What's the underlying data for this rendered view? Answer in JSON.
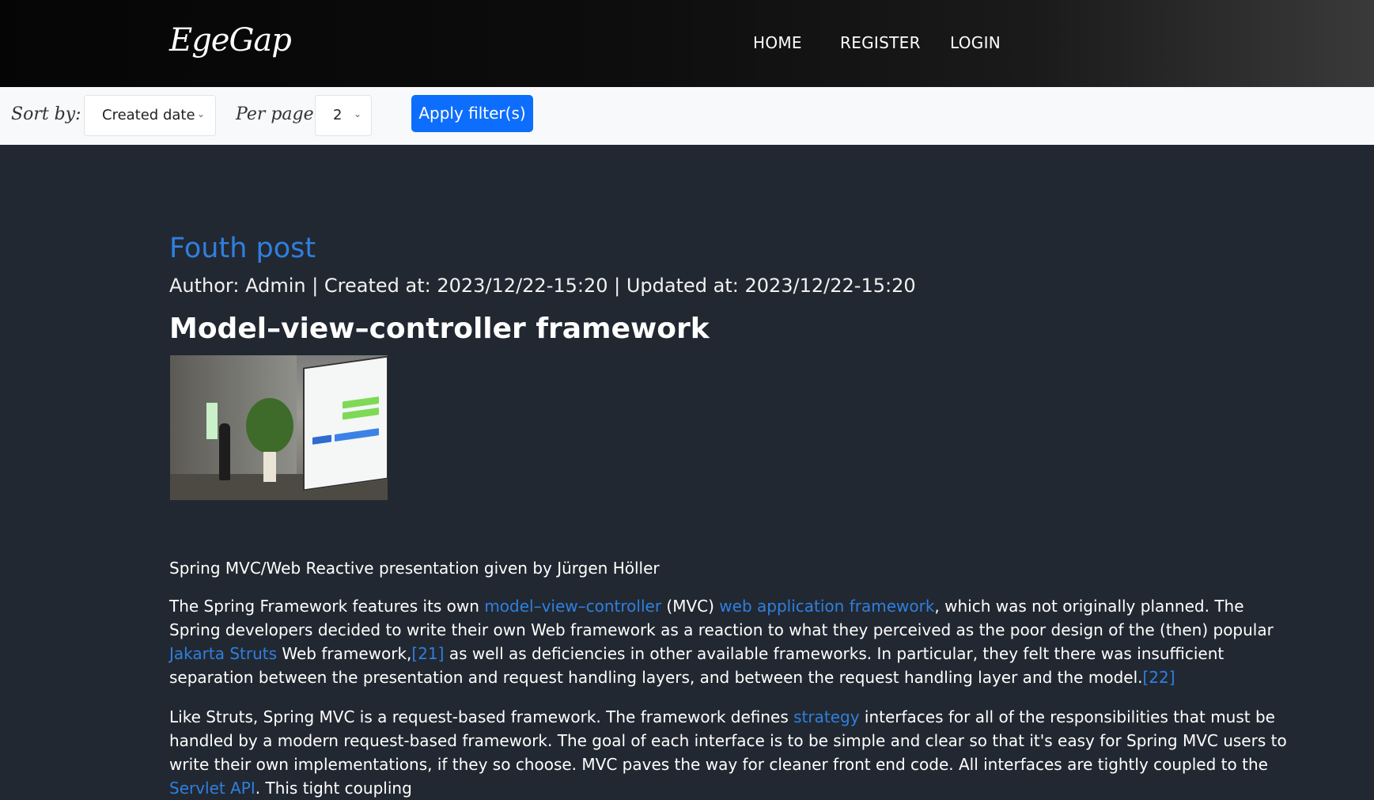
{
  "header": {
    "logo": "EgeGap",
    "nav": [
      "HOME",
      "REGISTER",
      "LOGIN"
    ]
  },
  "filters": {
    "sort_label": "Sort by:",
    "sort_value": "Created date",
    "per_page_label": "Per page:",
    "per_page_value": "2",
    "apply_label": "Apply filter(s)"
  },
  "post": {
    "title": "Fouth post",
    "meta": "Author: Admin | Created at: 2023/12/22-15:20 | Updated at: 2023/12/22-15:20",
    "heading": "Model–view–controller framework",
    "image_caption": "Spring MVC/Web Reactive presentation given by Jürgen Höller",
    "p1_a": "The Spring Framework features its own ",
    "p1_link1": "model–view–controller",
    "p1_b": " (MVC) ",
    "p1_link2": "web application framework",
    "p1_c": ", which was not originally planned. The Spring developers decided to write their own Web framework as a reaction to what they perceived as the poor design of the (then) popular ",
    "p1_link3": "Jakarta Struts",
    "p1_d": " Web framework,",
    "p1_ref1": "[21]",
    "p1_e": " as well as deficiencies in other available frameworks. In particular, they felt there was insufficient separation between the presentation and request handling layers, and between the request handling layer and the model.",
    "p1_ref2": "[22]",
    "p2_a": "Like Struts, Spring MVC is a request-based framework. The framework defines ",
    "p2_link1": "strategy",
    "p2_b": " interfaces for all of the responsibilities that must be handled by a modern request-based framework. The goal of each interface is to be simple and clear so that it's easy for Spring MVC users to write their own implementations, if they so choose. MVC paves the way for cleaner front end code. All interfaces are tightly coupled to the ",
    "p2_link2": "Servlet API",
    "p2_c": ". This tight coupling"
  },
  "colors": {
    "page_bg": "#222831",
    "link": "#2f7fe0",
    "primary_button": "#0d6efd"
  }
}
